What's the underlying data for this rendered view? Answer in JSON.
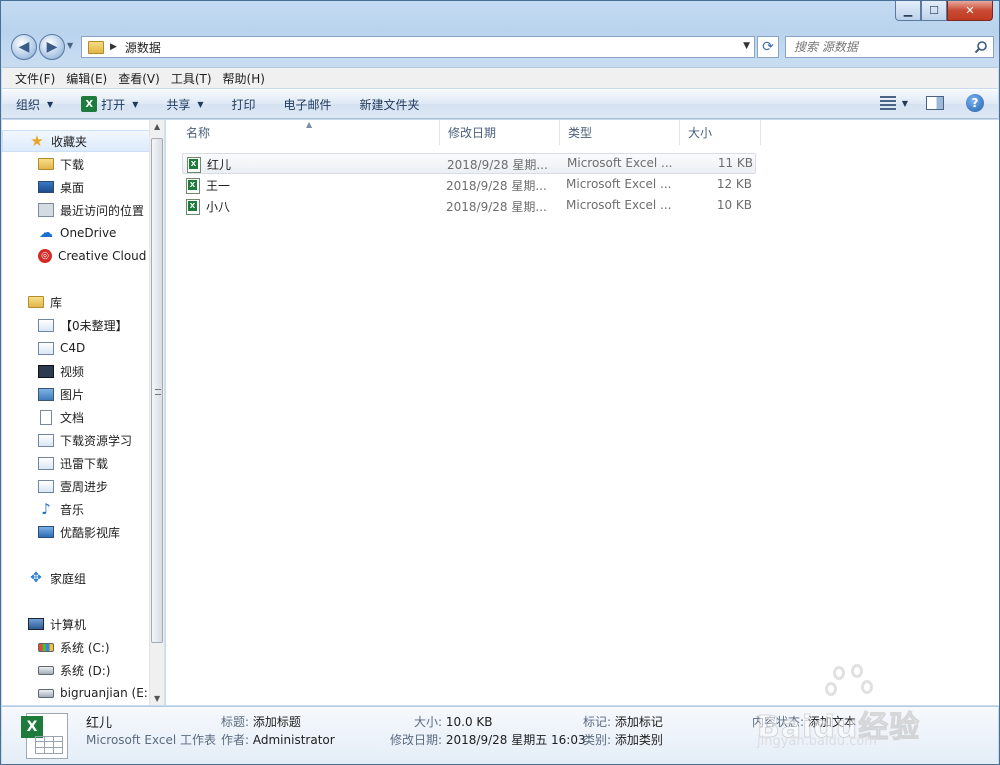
{
  "window": {
    "minimize": "▁",
    "maximize": "☐",
    "close": "✕"
  },
  "address": {
    "crumb": "源数据",
    "search_placeholder": "搜索 源数据"
  },
  "menu": [
    "文件(F)",
    "编辑(E)",
    "查看(V)",
    "工具(T)",
    "帮助(H)"
  ],
  "commands": {
    "organize": "组织",
    "open": "打开",
    "share": "共享",
    "print": "打印",
    "email": "电子邮件",
    "new_folder": "新建文件夹"
  },
  "nav": {
    "favorites": "收藏夹",
    "downloads": "下载",
    "desktop": "桌面",
    "recent": "最近访问的位置",
    "onedrive": "OneDrive",
    "creative_cloud": "Creative Cloud",
    "libraries": "库",
    "lib_items": [
      "【0未整理】",
      "C4D",
      "视频",
      "图片",
      "文档",
      "下载资源学习",
      "迅雷下载",
      "壹周进步",
      "音乐",
      "优酷影视库"
    ],
    "homegroup": "家庭组",
    "computer": "计算机",
    "drives": [
      "系统 (C:)",
      "系统 (D:)",
      "bigruanjian  (E:)"
    ]
  },
  "columns": {
    "name": "名称",
    "date": "修改日期",
    "type": "类型",
    "size": "大小"
  },
  "files": [
    {
      "name": "红儿",
      "date": "2018/9/28 星期...",
      "type": "Microsoft Excel ...",
      "size": "11 KB"
    },
    {
      "name": "王一",
      "date": "2018/9/28 星期...",
      "type": "Microsoft Excel ...",
      "size": "12 KB"
    },
    {
      "name": "小八",
      "date": "2018/9/28 星期...",
      "type": "Microsoft Excel ...",
      "size": "10 KB"
    }
  ],
  "details": {
    "filename": "红儿",
    "filetype": "Microsoft Excel 工作表",
    "title_k": "标题:",
    "title_v": "添加标题",
    "author_k": "作者:",
    "author_v": "Administrator",
    "size_k": "大小:",
    "size_v": "10.0 KB",
    "modified_k": "修改日期:",
    "modified_v": "2018/9/28 星期五 16:03",
    "tags_k": "标记:",
    "tags_v": "添加标记",
    "category_k": "类别:",
    "category_v": "添加类别",
    "content_k": "内容状态:",
    "content_v": "添加文本"
  },
  "watermark": {
    "brand": "Baidu经验",
    "url": "jingyan.baidu.com"
  }
}
